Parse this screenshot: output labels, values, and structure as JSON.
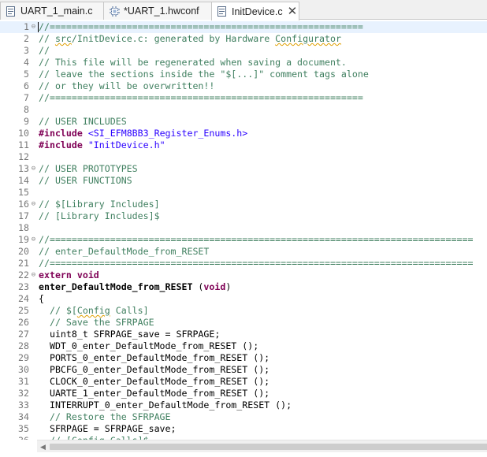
{
  "tabs": [
    {
      "label": "UART_1_main.c",
      "icon": "c-file-icon",
      "active": false,
      "closable": false
    },
    {
      "label": "*UART_1.hwconf",
      "icon": "hwconf-icon",
      "active": false,
      "closable": false
    },
    {
      "label": "InitDevice.c",
      "icon": "c-file-icon",
      "active": true,
      "closable": true
    }
  ],
  "editor": {
    "current_line": 1,
    "lines": [
      {
        "n": "1",
        "fold": "⊖",
        "tokens": [
          {
            "t": "//=========================================================",
            "c": "c"
          }
        ]
      },
      {
        "n": "2",
        "fold": "",
        "tokens": [
          {
            "t": "// ",
            "c": "c"
          },
          {
            "t": "src",
            "c": "c sq"
          },
          {
            "t": "/InitDevice.c: generated by Hardware ",
            "c": "c"
          },
          {
            "t": "Configurator",
            "c": "c sq"
          }
        ]
      },
      {
        "n": "3",
        "fold": "",
        "tokens": [
          {
            "t": "//",
            "c": "c"
          }
        ]
      },
      {
        "n": "4",
        "fold": "",
        "tokens": [
          {
            "t": "// This file will be regenerated when saving a document.",
            "c": "c"
          }
        ]
      },
      {
        "n": "5",
        "fold": "",
        "tokens": [
          {
            "t": "// leave the sections inside the \"$[...]\" comment tags alone",
            "c": "c"
          }
        ]
      },
      {
        "n": "6",
        "fold": "",
        "tokens": [
          {
            "t": "// or they will be overwritten!!",
            "c": "c"
          }
        ]
      },
      {
        "n": "7",
        "fold": "",
        "tokens": [
          {
            "t": "//=========================================================",
            "c": "c"
          }
        ]
      },
      {
        "n": "8",
        "fold": "",
        "tokens": []
      },
      {
        "n": "9",
        "fold": "",
        "tokens": [
          {
            "t": "// USER INCLUDES",
            "c": "c"
          }
        ]
      },
      {
        "n": "10",
        "fold": "",
        "tokens": [
          {
            "t": "#include ",
            "c": "k"
          },
          {
            "t": "<SI_EFM8BB3_Register_Enums.h>",
            "c": "s"
          }
        ]
      },
      {
        "n": "11",
        "fold": "",
        "tokens": [
          {
            "t": "#include ",
            "c": "k"
          },
          {
            "t": "\"InitDevice.h\"",
            "c": "s"
          }
        ]
      },
      {
        "n": "12",
        "fold": "",
        "tokens": []
      },
      {
        "n": "13",
        "fold": "⊖",
        "tokens": [
          {
            "t": "// USER PROTOTYPES",
            "c": "c"
          }
        ]
      },
      {
        "n": "14",
        "fold": "",
        "tokens": [
          {
            "t": "// USER FUNCTIONS",
            "c": "c"
          }
        ]
      },
      {
        "n": "15",
        "fold": "",
        "tokens": []
      },
      {
        "n": "16",
        "fold": "⊖",
        "tokens": [
          {
            "t": "// $[Library Includes]",
            "c": "c"
          }
        ]
      },
      {
        "n": "17",
        "fold": "",
        "tokens": [
          {
            "t": "// [Library Includes]$",
            "c": "c"
          }
        ]
      },
      {
        "n": "18",
        "fold": "",
        "tokens": []
      },
      {
        "n": "19",
        "fold": "⊖",
        "tokens": [
          {
            "t": "//=============================================================================",
            "c": "c"
          }
        ]
      },
      {
        "n": "20",
        "fold": "",
        "tokens": [
          {
            "t": "// enter_DefaultMode_from_RESET",
            "c": "c"
          }
        ]
      },
      {
        "n": "21",
        "fold": "",
        "tokens": [
          {
            "t": "//=============================================================================",
            "c": "c"
          }
        ]
      },
      {
        "n": "22",
        "fold": "⊖",
        "tokens": [
          {
            "t": "extern void",
            "c": "k"
          }
        ]
      },
      {
        "n": "23",
        "fold": "",
        "tokens": [
          {
            "t": "enter_DefaultMode_from_RESET",
            "c": "fn"
          },
          {
            "t": " (",
            "c": "p"
          },
          {
            "t": "void",
            "c": "k"
          },
          {
            "t": ")",
            "c": "p"
          }
        ]
      },
      {
        "n": "24",
        "fold": "",
        "tokens": [
          {
            "t": "{",
            "c": "p"
          }
        ]
      },
      {
        "n": "25",
        "fold": "",
        "tokens": [
          {
            "t": "  // $[",
            "c": "c"
          },
          {
            "t": "Config",
            "c": "c sq"
          },
          {
            "t": " Calls]",
            "c": "c"
          }
        ]
      },
      {
        "n": "26",
        "fold": "",
        "tokens": [
          {
            "t": "  // Save the SFRPAGE",
            "c": "c"
          }
        ]
      },
      {
        "n": "27",
        "fold": "",
        "tokens": [
          {
            "t": "  uint8_t SFRPAGE_save = SFRPAGE;",
            "c": "p"
          }
        ]
      },
      {
        "n": "28",
        "fold": "",
        "tokens": [
          {
            "t": "  WDT_0_enter_DefaultMode_from_RESET ();",
            "c": "p"
          }
        ]
      },
      {
        "n": "29",
        "fold": "",
        "tokens": [
          {
            "t": "  PORTS_0_enter_DefaultMode_from_RESET ();",
            "c": "p"
          }
        ]
      },
      {
        "n": "30",
        "fold": "",
        "tokens": [
          {
            "t": "  PBCFG_0_enter_DefaultMode_from_RESET ();",
            "c": "p"
          }
        ]
      },
      {
        "n": "31",
        "fold": "",
        "tokens": [
          {
            "t": "  CLOCK_0_enter_DefaultMode_from_RESET ();",
            "c": "p"
          }
        ]
      },
      {
        "n": "32",
        "fold": "",
        "tokens": [
          {
            "t": "  UARTE_1_enter_DefaultMode_from_RESET ();",
            "c": "p"
          }
        ]
      },
      {
        "n": "33",
        "fold": "",
        "tokens": [
          {
            "t": "  INTERRUPT_0_enter_DefaultMode_from_RESET ();",
            "c": "p"
          }
        ]
      },
      {
        "n": "34",
        "fold": "",
        "tokens": [
          {
            "t": "  // Restore the SFRPAGE",
            "c": "c"
          }
        ]
      },
      {
        "n": "35",
        "fold": "",
        "tokens": [
          {
            "t": "  SFRPAGE = SFRPAGE_save;",
            "c": "p"
          }
        ]
      },
      {
        "n": "36",
        "fold": "",
        "tokens": [
          {
            "t": "  // [Config Calls]$",
            "c": "c"
          }
        ]
      }
    ]
  },
  "colors": {
    "comment": "#3f7f5f",
    "keyword": "#7f0055",
    "string": "#2a00ff",
    "current_line": "#e8f2fe"
  }
}
